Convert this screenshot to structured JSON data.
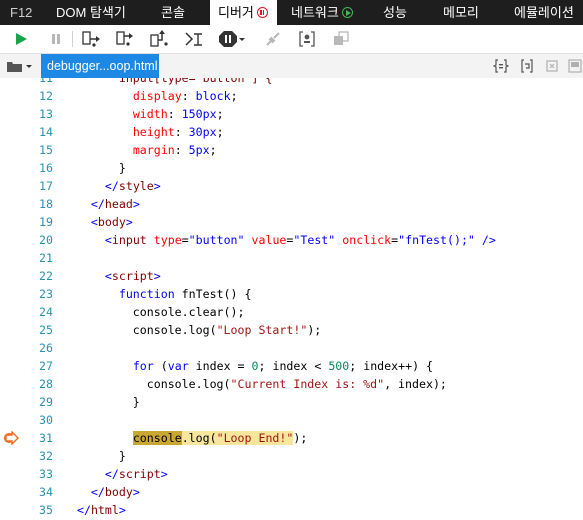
{
  "tabs": [
    {
      "label": "F12",
      "active": false
    },
    {
      "label": "DOM 탐색기",
      "active": false
    },
    {
      "label": "콘솔",
      "active": false
    },
    {
      "label": "디버거",
      "active": true
    },
    {
      "label": "네트워크",
      "active": false
    },
    {
      "label": "성능",
      "active": false
    },
    {
      "label": "메모리",
      "active": false
    },
    {
      "label": "에뮬레이션",
      "active": false
    }
  ],
  "toolbar": {
    "icons": [
      "continue-icon",
      "break-icon",
      "step-into-icon",
      "step-over-icon",
      "step-out-icon",
      "break-on-new-worker-icon",
      "exception-behavior-icon",
      "disconnect-icon",
      "breakpoint-list-icon",
      "pretty-print-icon"
    ]
  },
  "file_strip": {
    "active_file": "debugger...oop.html",
    "right_icons": [
      "format-icon",
      "word-wrap-icon",
      "source-map-icon",
      "toggle-panel-icon"
    ]
  },
  "code": {
    "current_line": 31,
    "lines": [
      {
        "n": "11",
        "tokens": [
          {
            "t": "        input[type= button ] {",
            "c": "tag"
          }
        ]
      },
      {
        "n": "12",
        "tokens": [
          {
            "t": "          ",
            "c": "plain"
          },
          {
            "t": "display",
            "c": "prop"
          },
          {
            "t": ": ",
            "c": "plain"
          },
          {
            "t": "block",
            "c": "val"
          },
          {
            "t": ";",
            "c": "plain"
          }
        ]
      },
      {
        "n": "13",
        "tokens": [
          {
            "t": "          ",
            "c": "plain"
          },
          {
            "t": "width",
            "c": "prop"
          },
          {
            "t": ": ",
            "c": "plain"
          },
          {
            "t": "150px",
            "c": "val"
          },
          {
            "t": ";",
            "c": "plain"
          }
        ]
      },
      {
        "n": "14",
        "tokens": [
          {
            "t": "          ",
            "c": "plain"
          },
          {
            "t": "height",
            "c": "prop"
          },
          {
            "t": ": ",
            "c": "plain"
          },
          {
            "t": "30px",
            "c": "val"
          },
          {
            "t": ";",
            "c": "plain"
          }
        ]
      },
      {
        "n": "15",
        "tokens": [
          {
            "t": "          ",
            "c": "plain"
          },
          {
            "t": "margin",
            "c": "prop"
          },
          {
            "t": ": ",
            "c": "plain"
          },
          {
            "t": "5px",
            "c": "val"
          },
          {
            "t": ";",
            "c": "plain"
          }
        ]
      },
      {
        "n": "16",
        "tokens": [
          {
            "t": "        }",
            "c": "plain"
          }
        ]
      },
      {
        "n": "17",
        "tokens": [
          {
            "t": "      ",
            "c": "plain"
          },
          {
            "t": "</",
            "c": "bracket"
          },
          {
            "t": "style",
            "c": "tag"
          },
          {
            "t": ">",
            "c": "bracket"
          }
        ]
      },
      {
        "n": "18",
        "tokens": [
          {
            "t": "    ",
            "c": "plain"
          },
          {
            "t": "</",
            "c": "bracket"
          },
          {
            "t": "head",
            "c": "tag"
          },
          {
            "t": ">",
            "c": "bracket"
          }
        ]
      },
      {
        "n": "19",
        "tokens": [
          {
            "t": "    ",
            "c": "plain"
          },
          {
            "t": "<",
            "c": "bracket"
          },
          {
            "t": "body",
            "c": "tag"
          },
          {
            "t": ">",
            "c": "bracket"
          }
        ]
      },
      {
        "n": "20",
        "tokens": [
          {
            "t": "      ",
            "c": "plain"
          },
          {
            "t": "<",
            "c": "bracket"
          },
          {
            "t": "input",
            "c": "tag"
          },
          {
            "t": " ",
            "c": "plain"
          },
          {
            "t": "type",
            "c": "attr"
          },
          {
            "t": "=",
            "c": "plain"
          },
          {
            "t": "\"button\"",
            "c": "val"
          },
          {
            "t": " ",
            "c": "plain"
          },
          {
            "t": "value",
            "c": "attr"
          },
          {
            "t": "=",
            "c": "plain"
          },
          {
            "t": "\"Test\"",
            "c": "val"
          },
          {
            "t": " ",
            "c": "plain"
          },
          {
            "t": "onclick",
            "c": "attr"
          },
          {
            "t": "=",
            "c": "plain"
          },
          {
            "t": "\"fnTest();\"",
            "c": "val"
          },
          {
            "t": " />",
            "c": "bracket"
          }
        ]
      },
      {
        "n": "21",
        "tokens": []
      },
      {
        "n": "22",
        "tokens": [
          {
            "t": "      ",
            "c": "plain"
          },
          {
            "t": "<",
            "c": "bracket"
          },
          {
            "t": "script",
            "c": "tag"
          },
          {
            "t": ">",
            "c": "bracket"
          }
        ]
      },
      {
        "n": "23",
        "tokens": [
          {
            "t": "        ",
            "c": "plain"
          },
          {
            "t": "function",
            "c": "kw"
          },
          {
            "t": " fnTest() {",
            "c": "plain"
          }
        ]
      },
      {
        "n": "24",
        "tokens": [
          {
            "t": "          console.clear();",
            "c": "plain"
          }
        ]
      },
      {
        "n": "25",
        "tokens": [
          {
            "t": "          console.log(",
            "c": "plain"
          },
          {
            "t": "\"Loop Start!\"",
            "c": "str"
          },
          {
            "t": ");",
            "c": "plain"
          }
        ]
      },
      {
        "n": "26",
        "tokens": []
      },
      {
        "n": "27",
        "tokens": [
          {
            "t": "          ",
            "c": "plain"
          },
          {
            "t": "for",
            "c": "kw"
          },
          {
            "t": " (",
            "c": "plain"
          },
          {
            "t": "var",
            "c": "kw"
          },
          {
            "t": " index = ",
            "c": "plain"
          },
          {
            "t": "0",
            "c": "num"
          },
          {
            "t": "; index < ",
            "c": "plain"
          },
          {
            "t": "500",
            "c": "num"
          },
          {
            "t": "; index++) {",
            "c": "plain"
          }
        ]
      },
      {
        "n": "28",
        "tokens": [
          {
            "t": "            console.log(",
            "c": "plain"
          },
          {
            "t": "\"Current Index is: %d\"",
            "c": "str"
          },
          {
            "t": ", index);",
            "c": "plain"
          }
        ]
      },
      {
        "n": "29",
        "tokens": [
          {
            "t": "          }",
            "c": "plain"
          }
        ]
      },
      {
        "n": "30",
        "tokens": []
      },
      {
        "n": "31",
        "tokens": [
          {
            "t": "          ",
            "c": "plain"
          },
          {
            "t": "console",
            "c": "plain",
            "hl": "cursor"
          },
          {
            "t": ".log(",
            "c": "plain",
            "hl": "line"
          },
          {
            "t": "\"Loop End!\"",
            "c": "str",
            "hl": "line"
          },
          {
            "t": ");",
            "c": "plain"
          }
        ]
      },
      {
        "n": "32",
        "tokens": [
          {
            "t": "        }",
            "c": "plain"
          }
        ]
      },
      {
        "n": "33",
        "tokens": [
          {
            "t": "      ",
            "c": "plain"
          },
          {
            "t": "</",
            "c": "bracket"
          },
          {
            "t": "script",
            "c": "tag"
          },
          {
            "t": ">",
            "c": "bracket"
          }
        ]
      },
      {
        "n": "34",
        "tokens": [
          {
            "t": "    ",
            "c": "plain"
          },
          {
            "t": "</",
            "c": "bracket"
          },
          {
            "t": "body",
            "c": "tag"
          },
          {
            "t": ">",
            "c": "bracket"
          }
        ]
      },
      {
        "n": "35",
        "tokens": [
          {
            "t": "  ",
            "c": "plain"
          },
          {
            "t": "</",
            "c": "bracket"
          },
          {
            "t": "html",
            "c": "tag"
          },
          {
            "t": ">",
            "c": "bracket"
          }
        ]
      }
    ]
  },
  "colors": {
    "tabbar_bg": "#1e1e1e",
    "file_tab_bg": "#1e88e5",
    "continue_green": "#1aa34a",
    "breakpoint_orange": "#f26b1d",
    "line_highlight": "#f7e69c"
  }
}
